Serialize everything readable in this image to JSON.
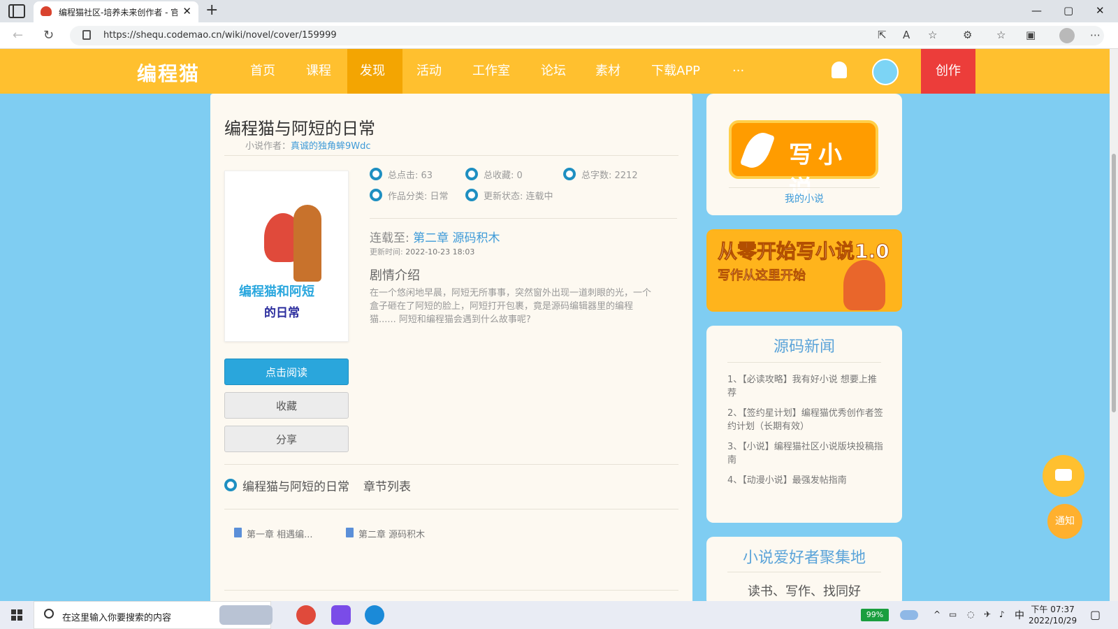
{
  "browser": {
    "tab_title": "编程猫社区-培养未来创作者 - 官",
    "tab_close": "✕",
    "new_tab": "+",
    "url": "https://shequ.codemao.cn/wiki/novel/cover/159999",
    "win_min": "—",
    "win_max": "▢",
    "win_close": "✕",
    "back": "←",
    "reload": "↻",
    "more": "⋯"
  },
  "header": {
    "logo": "编程猫",
    "nav": [
      "首页",
      "课程",
      "发现",
      "活动",
      "工作室",
      "论坛",
      "素材",
      "下载APP",
      "···"
    ],
    "active_index": 2,
    "create": "创作"
  },
  "novel": {
    "title": "编程猫与阿短的日常",
    "author_label": "小说作者：",
    "author": "真诚的独角蛑9Wdc",
    "cover_line1": "编程猫和阿短",
    "cover_line2": "的日常",
    "stats": {
      "clicks": "总点击: 63",
      "favorites": "总收藏: 0",
      "words": "总字数: 2212",
      "category": "作品分类: 日常",
      "status": "更新状态: 连载中"
    },
    "serial_label": "连载至: ",
    "serial_chapter": "第二章 源码积木",
    "update_label": "更新时间: ",
    "update_time": "2022-10-23 18:03",
    "plot_heading": "剧情介绍",
    "plot": "在一个悠闲地早晨，阿短无所事事，突然窗外出现一道刺眼的光，一个盒子砸在了阿短的脸上，阿短打开包裹，竟是源码编辑器里的编程猫...... 阿短和编程猫会遇到什么故事呢?",
    "read_button": "点击阅读",
    "fav_button": "收藏",
    "share_button": "分享",
    "chapter_heading": "编程猫与阿短的日常",
    "chapter_sub": "章节列表",
    "chapters": [
      "第一章 相遇编...",
      "第二章 源码积木"
    ]
  },
  "sidebar": {
    "write_novel": "写小说",
    "my_novel": "我的小说",
    "banner_line1": "从零开始写小说1.0",
    "banner_line2": "写作从这里开始",
    "news_title": "源码新闻",
    "news": [
      "1、【必读攻略】我有好小说 想要上推荐",
      "2、【签约星计划】编程猫优秀创作者签约计划（长期有效）",
      "3、【小说】编程猫社区小说版块投稿指南",
      "4、【动漫小说】最强发帖指南"
    ],
    "fans_title": "小说爱好者聚集地",
    "fans_sub": "读书、写作、找同好"
  },
  "floating": {
    "notice": "通知"
  },
  "taskbar": {
    "search_placeholder": "在这里输入你要搜索的内容",
    "battery": "99%",
    "ime": "中",
    "time": "下午 07:37",
    "date": "2022/10/29"
  }
}
